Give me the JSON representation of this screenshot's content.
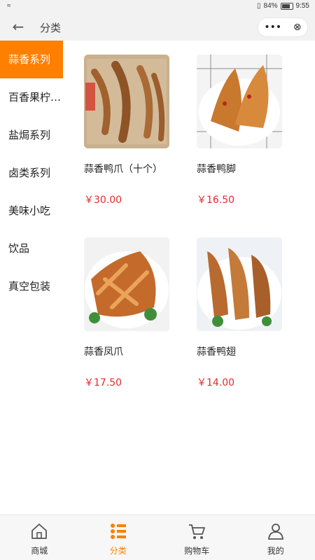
{
  "status": {
    "left": "≈",
    "battery_text": "84%",
    "time": "9:55"
  },
  "header": {
    "title": "分类",
    "more_icon": "more-dots-icon",
    "close_icon": "close-circle-icon"
  },
  "sidebar": {
    "items": [
      {
        "label": "蒜香系列",
        "active": true
      },
      {
        "label": "百香果柠…",
        "active": false
      },
      {
        "label": "盐焗系列",
        "active": false
      },
      {
        "label": "卤类系列",
        "active": false
      },
      {
        "label": "美味小吃",
        "active": false
      },
      {
        "label": "饮品",
        "active": false
      },
      {
        "label": "真空包装",
        "active": false
      }
    ]
  },
  "products": [
    {
      "name": "蒜香鸭爪（十个）",
      "price": "￥30.00"
    },
    {
      "name": "蒜香鸭脚",
      "price": "￥16.50"
    },
    {
      "name": "蒜香凤爪",
      "price": "￥17.50"
    },
    {
      "name": "蒜香鸭翅",
      "price": "￥14.00"
    }
  ],
  "tabbar": {
    "items": [
      {
        "label": "商城",
        "icon": "home-icon"
      },
      {
        "label": "分类",
        "icon": "category-list-icon"
      },
      {
        "label": "购物车",
        "icon": "cart-icon"
      },
      {
        "label": "我的",
        "icon": "user-icon"
      }
    ]
  },
  "colors": {
    "accent": "#ff7f00",
    "price": "#e62a2a"
  }
}
